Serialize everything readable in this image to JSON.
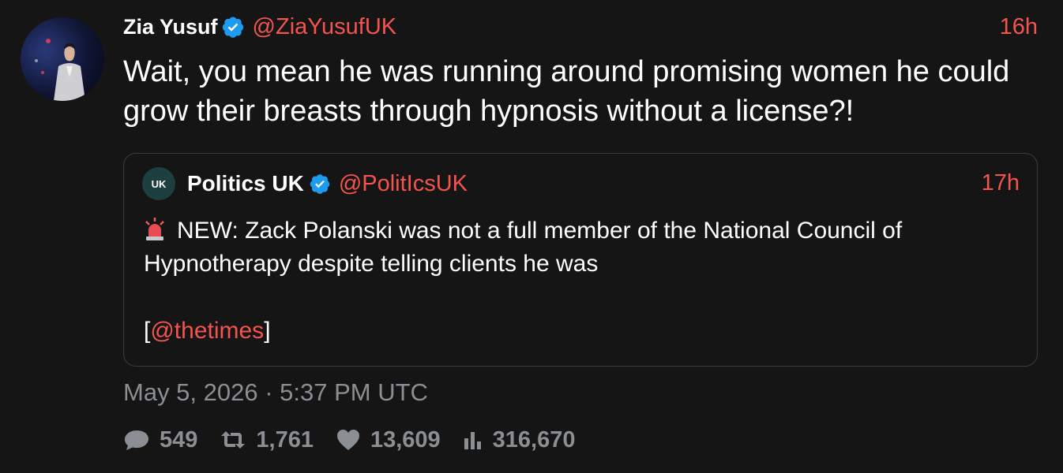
{
  "author": {
    "name": "Zia Yusuf",
    "handle": "@ZiaYusufUK",
    "time": "16h",
    "verified": true
  },
  "tweet": {
    "text": "Wait, you mean he was running around promising women he could grow their breasts through hypnosis without a license?!"
  },
  "quoted": {
    "name": "Politics UK",
    "handle": "@PolitIcsUK",
    "time": "17h",
    "verified": true,
    "avatar_text": "UK",
    "emoji": "siren-icon",
    "text": "NEW: Zack Polanski was not a full member of the National Council of Hypnotherapy despite telling clients he was",
    "source_open": "[",
    "source_link": "@thetimes",
    "source_close": "]"
  },
  "timestamp": "May 5, 2026 · 5:37 PM UTC",
  "stats": {
    "replies": "549",
    "retweets": "1,761",
    "likes": "13,609",
    "views": "316,670"
  },
  "colors": {
    "accent": "#f4544f",
    "verified": "#1d9bf0",
    "muted": "#8b8f93",
    "background": "#151515"
  }
}
